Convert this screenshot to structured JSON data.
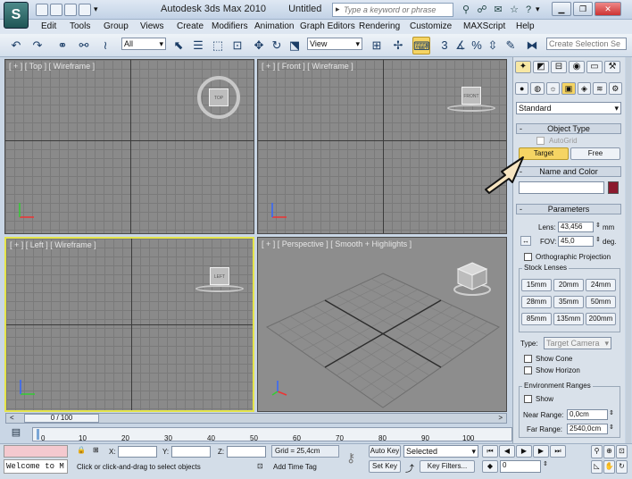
{
  "window": {
    "app_title": "Autodesk 3ds Max 2010",
    "doc_title": "Untitled"
  },
  "search": {
    "placeholder": "Type a keyword or phrase"
  },
  "menu": [
    "Edit",
    "Tools",
    "Group",
    "Views",
    "Create",
    "Modifiers",
    "Animation",
    "Graph Editors",
    "Rendering",
    "Customize",
    "MAXScript",
    "Help"
  ],
  "toolbar": {
    "selection_filter": "All",
    "ref_coord": "View",
    "named_selection": "Create Selection Se"
  },
  "viewports": {
    "top": {
      "label": "[ + ] [ Top ] [ Wireframe ]",
      "cube": "TOP"
    },
    "front": {
      "label": "[ + ] [ Front ] [ Wireframe ]",
      "cube": "FRONT"
    },
    "left": {
      "label": "[ + ] [ Left ] [ Wireframe ]",
      "cube": "LEFT"
    },
    "perspective": {
      "label": "[ + ] [ Perspective ] [ Smooth + Highlights ]"
    }
  },
  "command_panel": {
    "category": "Standard",
    "object_type": {
      "title": "Object Type",
      "autogrid": "AutoGrid",
      "target": "Target",
      "free": "Free"
    },
    "name_color": {
      "title": "Name and Color",
      "color": "#8b1a2e"
    },
    "parameters": {
      "title": "Parameters",
      "lens_label": "Lens:",
      "lens_value": "43,456",
      "lens_unit": "mm",
      "fov_label": "FOV:",
      "fov_value": "45,0",
      "fov_unit": "deg.",
      "ortho": "Orthographic Projection",
      "stock_lenses": "Stock Lenses",
      "lenses": [
        "15mm",
        "20mm",
        "24mm",
        "28mm",
        "35mm",
        "50mm",
        "85mm",
        "135mm",
        "200mm"
      ],
      "type_label": "Type:",
      "type_value": "Target Camera",
      "show_cone": "Show Cone",
      "show_horizon": "Show Horizon",
      "env_ranges": "Environment Ranges",
      "env_show": "Show",
      "near_label": "Near Range:",
      "near_value": "0,0cm",
      "far_label": "Far Range:",
      "far_value": "2540,0cm"
    }
  },
  "timeline": {
    "frame": "0 / 100",
    "ticks": [
      "0",
      "10",
      "20",
      "30",
      "40",
      "50",
      "60",
      "70",
      "80",
      "90",
      "100"
    ]
  },
  "status": {
    "listener": "Welcome to M",
    "prompt": "Click or click-and-drag to select objects",
    "x_label": "X:",
    "y_label": "Y:",
    "z_label": "Z:",
    "grid": "Grid = 25,4cm",
    "add_time_tag": "Add Time Tag",
    "auto_key": "Auto Key",
    "set_key": "Set Key",
    "key_mode": "Selected",
    "key_filters": "Key Filters...",
    "current_frame": "0"
  }
}
